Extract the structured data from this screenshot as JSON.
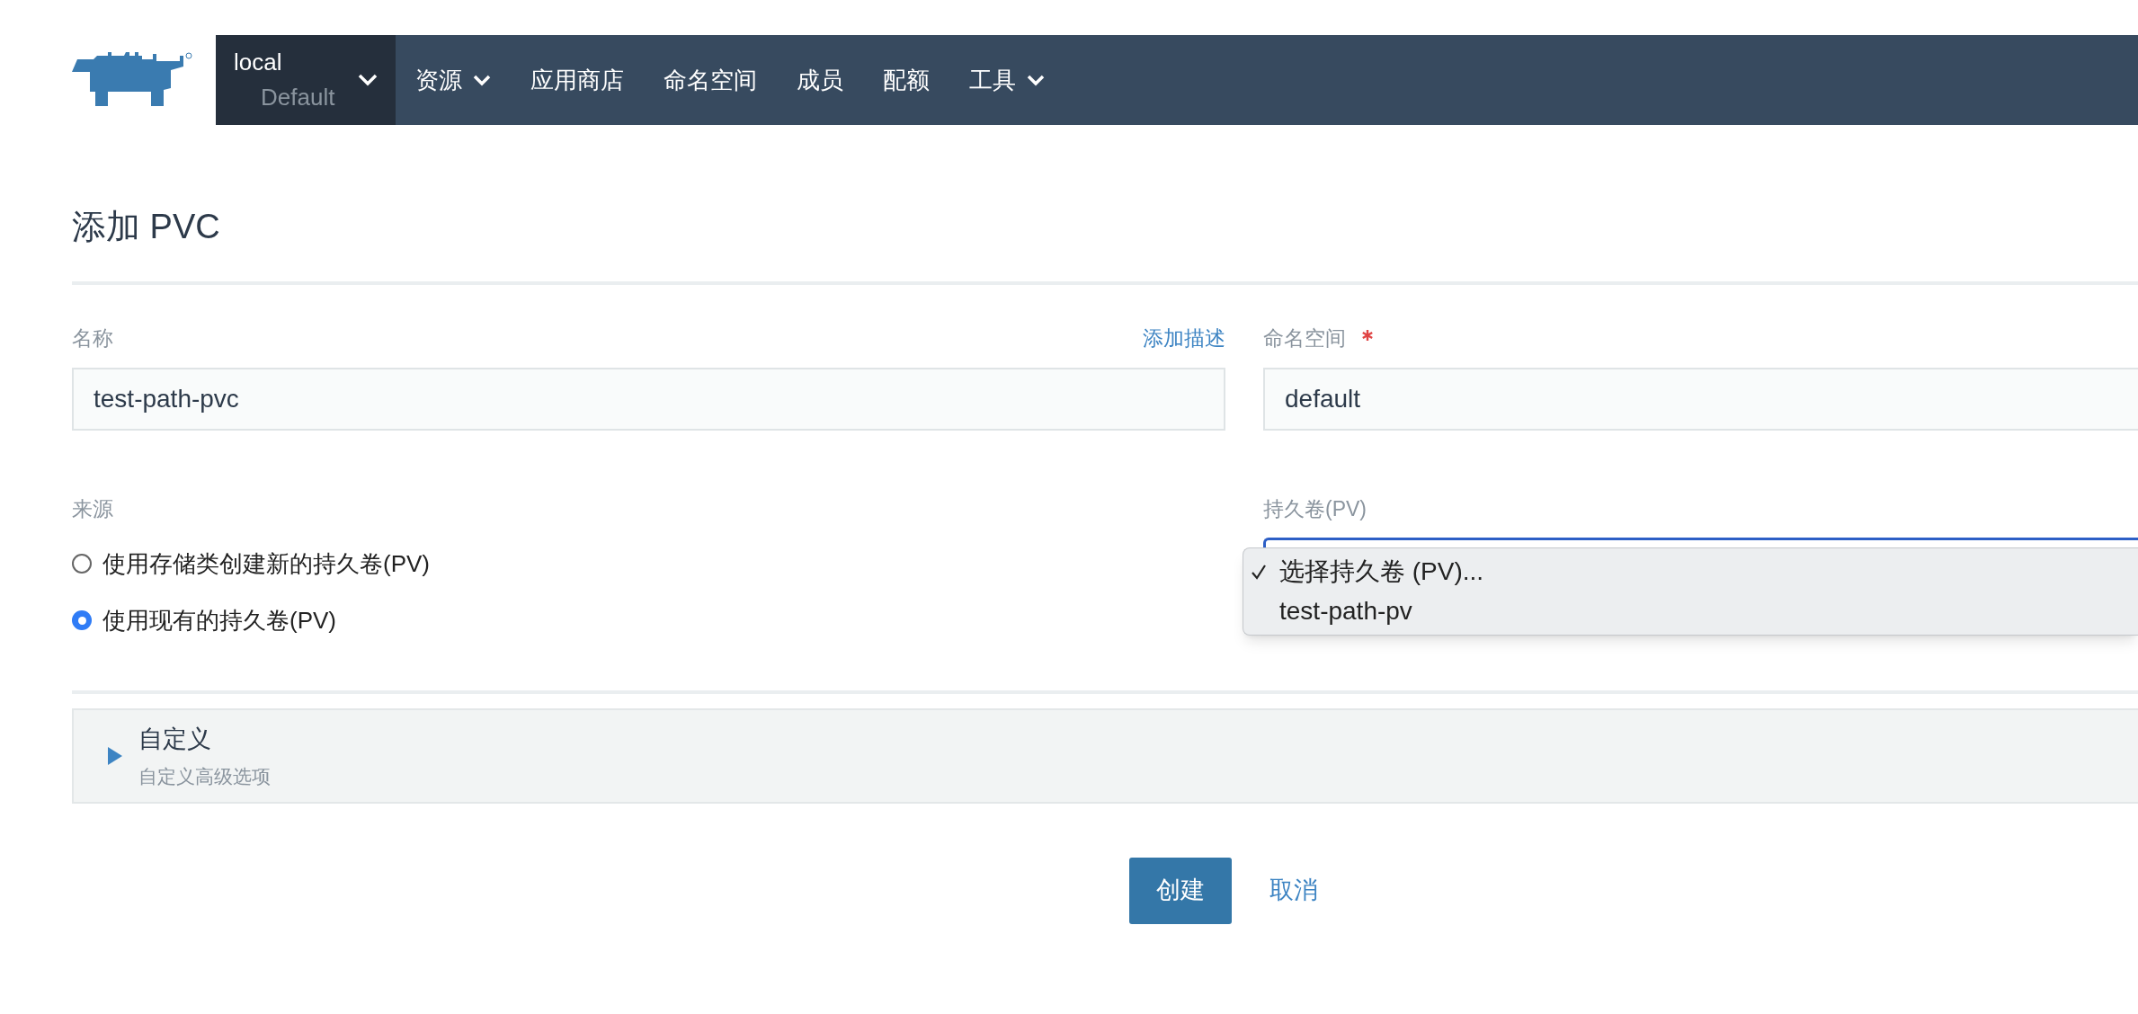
{
  "nav": {
    "cluster": {
      "name": "local",
      "project": "Default"
    },
    "items": [
      {
        "label": "资源",
        "dropdown": true
      },
      {
        "label": "应用商店",
        "dropdown": false
      },
      {
        "label": "命名空间",
        "dropdown": false
      },
      {
        "label": "成员",
        "dropdown": false
      },
      {
        "label": "配额",
        "dropdown": false
      },
      {
        "label": "工具",
        "dropdown": true
      }
    ]
  },
  "page_title": "添加 PVC",
  "form": {
    "name": {
      "label": "名称",
      "value": "test-path-pvc",
      "link": "添加描述"
    },
    "namespace": {
      "label": "命名空间",
      "required": true,
      "value": "default"
    },
    "source": {
      "label": "来源",
      "options": [
        {
          "label": "使用存储类创建新的持久卷(PV)",
          "selected": false
        },
        {
          "label": "使用现有的持久卷(PV)",
          "selected": true
        }
      ]
    },
    "pv": {
      "label": "持久卷(PV)",
      "menu": [
        {
          "label": "选择持久卷 (PV)...",
          "selected": true
        },
        {
          "label": "test-path-pv",
          "selected": false
        }
      ]
    }
  },
  "customize": {
    "title": "自定义",
    "subtitle": "自定义高级选项",
    "expanded": false
  },
  "buttons": [
    {
      "label": "创建",
      "kind": "primary"
    },
    {
      "label": "取消",
      "kind": "link"
    }
  ]
}
